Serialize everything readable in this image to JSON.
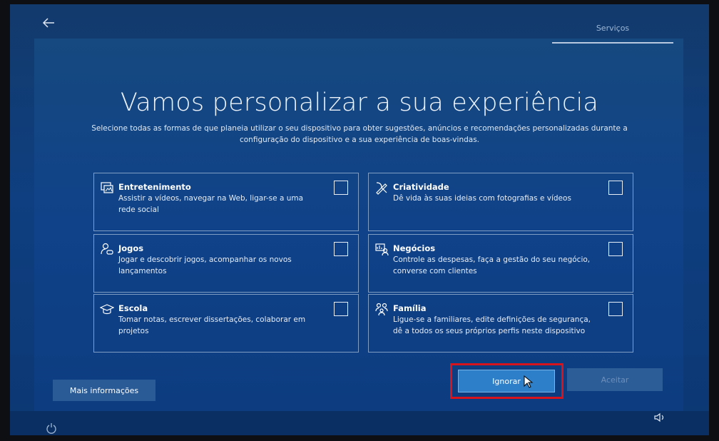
{
  "header": {
    "tab": "Serviços"
  },
  "title": "Vamos personalizar a sua experiência",
  "subtitle": "Selecione todas as formas de que planeia utilizar o seu dispositivo para obter sugestões, anúncios e recomendações personalizadas durante a configuração do dispositivo e a sua experiência de boas-vindas.",
  "options": [
    {
      "name": "Entretenimento",
      "description": "Assistir a vídeos, navegar na Web, ligar-se a uma rede social",
      "icon": "entertainment-icon",
      "checked": false
    },
    {
      "name": "Criatividade",
      "description": "Dê vida às suas ideias com fotografias e vídeos",
      "icon": "creativity-icon",
      "checked": false
    },
    {
      "name": "Jogos",
      "description": "Jogar e descobrir jogos, acompanhar os novos lançamentos",
      "icon": "gaming-icon",
      "checked": false
    },
    {
      "name": "Negócios",
      "description": "Controle as despesas, faça a gestão do seu negócio, converse com clientes",
      "icon": "business-icon",
      "checked": false
    },
    {
      "name": "Escola",
      "description": "Tomar notas, escrever dissertações, colaborar em projetos",
      "icon": "school-icon",
      "checked": false
    },
    {
      "name": "Família",
      "description": "Ligue-se a familiares, edite definições de segurança, dê a todos os seus próprios perfis neste dispositivo",
      "icon": "family-icon",
      "checked": false
    }
  ],
  "buttons": {
    "more_info": "Mais informações",
    "skip": "Ignorar",
    "accept": "Aceitar"
  },
  "colors": {
    "background": "#0f4289",
    "highlight": "#d8131b",
    "primary_button": "#2e7fc9"
  }
}
